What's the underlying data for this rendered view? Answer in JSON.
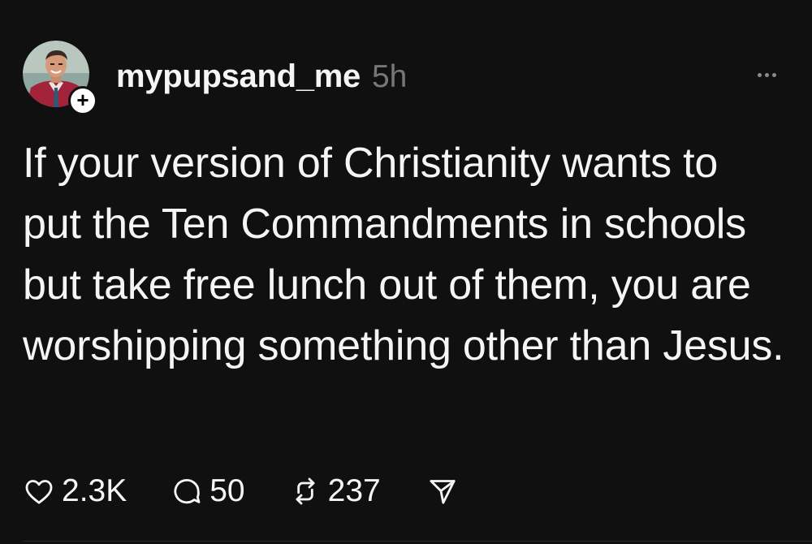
{
  "post": {
    "username": "mypupsand_me",
    "timestamp": "5h",
    "follow_symbol": "+",
    "text": "If your version of Christianity wants to put the Ten Commandments in schools but take free lunch out of them, you are worshipping something other than Jesus.",
    "actions": {
      "likes": "2.3K",
      "replies": "50",
      "reposts": "237"
    }
  },
  "icons": {
    "like": "heart-icon",
    "reply": "speech-bubble-icon",
    "repost": "repost-arrows-icon",
    "share": "paper-plane-icon",
    "more": "more-horizontal-icon"
  },
  "colors": {
    "background": "#101010",
    "text_primary": "#f3f5f7",
    "text_secondary": "#777777",
    "follow_badge": "#ffffff"
  }
}
